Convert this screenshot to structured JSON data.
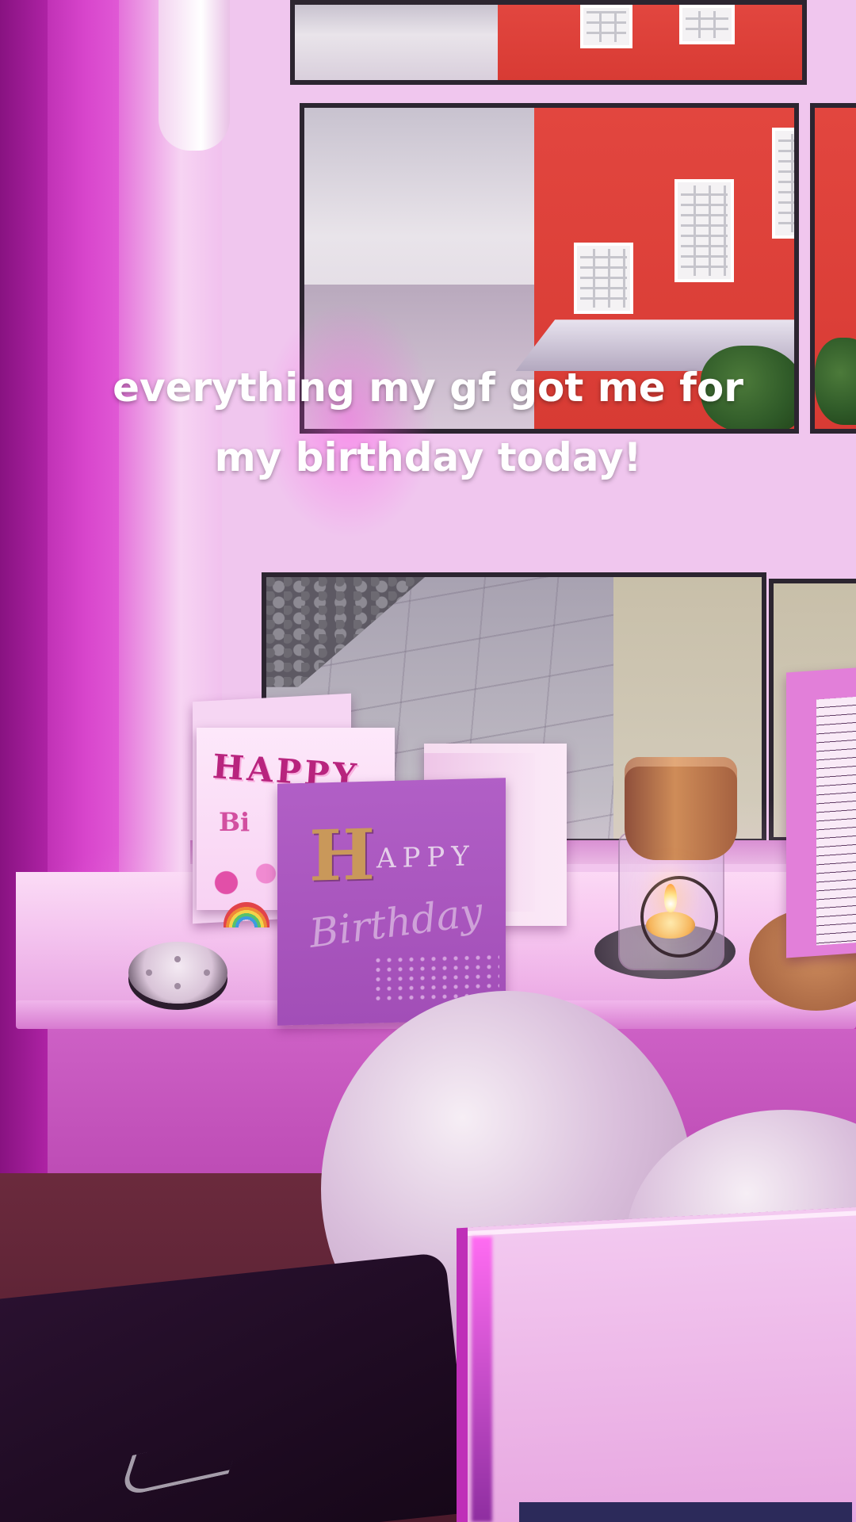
{
  "caption": {
    "line1": "everything my gf got me for",
    "line2": "my birthday today!"
  },
  "cards": {
    "colorful_card": {
      "text_top": "HAPPY",
      "text_bottom": "Bi"
    },
    "purple_card": {
      "initial": "H",
      "rest": "APPY",
      "script": "Birthday"
    }
  },
  "colors": {
    "caption_text": "#ffffff",
    "ambient_light": "#c43cb0",
    "building": "#d83b34",
    "purple_card": "#a24eb7",
    "candle_cup": "#cf8c58"
  }
}
